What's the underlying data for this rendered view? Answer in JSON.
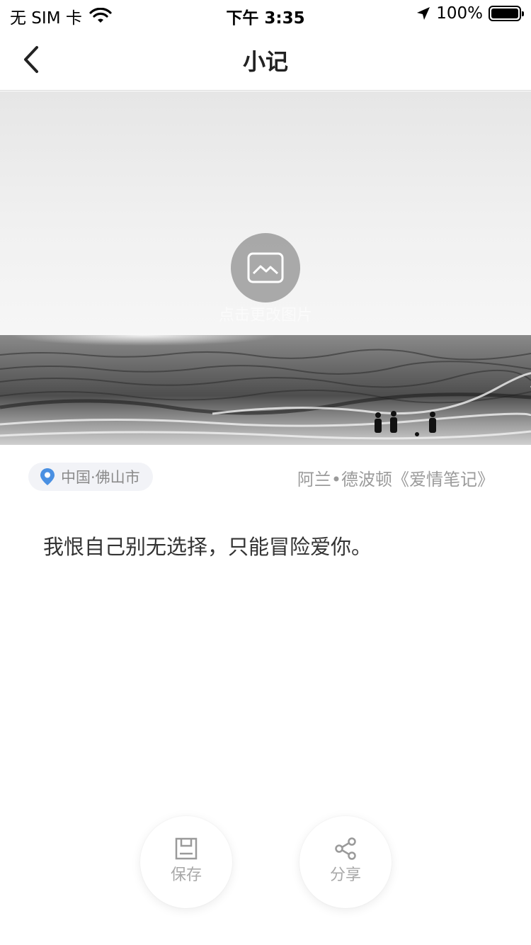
{
  "status_bar": {
    "carrier": "无 SIM 卡",
    "time": "下午 3:35",
    "battery_percent": "100%",
    "battery_level": 1.0
  },
  "nav": {
    "title": "小记"
  },
  "photo": {
    "change_label": "点击更改图片"
  },
  "meta": {
    "location": "中国·佛山市",
    "source": "阿兰•德波顿《爱情笔记》"
  },
  "note": {
    "text": "我恨自己别无选择，只能冒险爱你。"
  },
  "actions": {
    "save_label": "保存",
    "share_label": "分享"
  },
  "colors": {
    "pin": "#4a90e2",
    "chip_bg": "#f2f3f7",
    "divider": "#d8d8d8"
  }
}
